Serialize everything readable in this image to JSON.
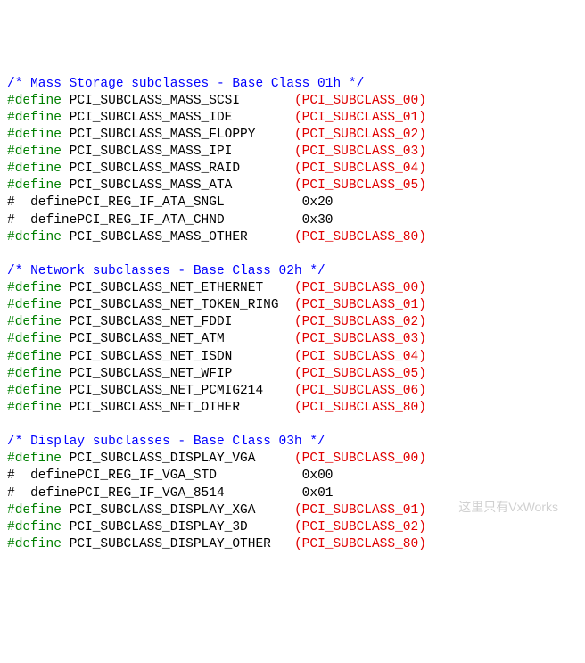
{
  "sections": [
    {
      "comment": "/* Mass Storage subclasses - Base Class 01h */",
      "lines": [
        {
          "directive": "#define",
          "name": "PCI_SUBCLASS_MASS_SCSI",
          "value": "(PCI_SUBCLASS_00)",
          "mode": "green"
        },
        {
          "directive": "#define",
          "name": "PCI_SUBCLASS_MASS_IDE",
          "value": "(PCI_SUBCLASS_01)",
          "mode": "green"
        },
        {
          "directive": "#define",
          "name": "PCI_SUBCLASS_MASS_FLOPPY",
          "value": "(PCI_SUBCLASS_02)",
          "mode": "green"
        },
        {
          "directive": "#define",
          "name": "PCI_SUBCLASS_MASS_IPI",
          "value": "(PCI_SUBCLASS_03)",
          "mode": "green"
        },
        {
          "directive": "#define",
          "name": "PCI_SUBCLASS_MASS_RAID",
          "value": "(PCI_SUBCLASS_04)",
          "mode": "green"
        },
        {
          "directive": "#define",
          "name": "PCI_SUBCLASS_MASS_ATA",
          "value": "(PCI_SUBCLASS_05)",
          "mode": "green"
        },
        {
          "directive": "#  define",
          "name": "PCI_REG_IF_ATA_SNGL",
          "value": "0x20",
          "mode": "black"
        },
        {
          "directive": "#  define",
          "name": "PCI_REG_IF_ATA_CHND",
          "value": "0x30",
          "mode": "black"
        },
        {
          "directive": "#define",
          "name": "PCI_SUBCLASS_MASS_OTHER",
          "value": "(PCI_SUBCLASS_80)",
          "mode": "green"
        }
      ]
    },
    {
      "comment": "/* Network subclasses - Base Class 02h */",
      "lines": [
        {
          "directive": "#define",
          "name": "PCI_SUBCLASS_NET_ETHERNET",
          "value": "(PCI_SUBCLASS_00)",
          "mode": "green"
        },
        {
          "directive": "#define",
          "name": "PCI_SUBCLASS_NET_TOKEN_RING",
          "value": "(PCI_SUBCLASS_01)",
          "mode": "green"
        },
        {
          "directive": "#define",
          "name": "PCI_SUBCLASS_NET_FDDI",
          "value": "(PCI_SUBCLASS_02)",
          "mode": "green"
        },
        {
          "directive": "#define",
          "name": "PCI_SUBCLASS_NET_ATM",
          "value": "(PCI_SUBCLASS_03)",
          "mode": "green"
        },
        {
          "directive": "#define",
          "name": "PCI_SUBCLASS_NET_ISDN",
          "value": "(PCI_SUBCLASS_04)",
          "mode": "green"
        },
        {
          "directive": "#define",
          "name": "PCI_SUBCLASS_NET_WFIP",
          "value": "(PCI_SUBCLASS_05)",
          "mode": "green"
        },
        {
          "directive": "#define",
          "name": "PCI_SUBCLASS_NET_PCMIG214",
          "value": "(PCI_SUBCLASS_06)",
          "mode": "green"
        },
        {
          "directive": "#define",
          "name": "PCI_SUBCLASS_NET_OTHER",
          "value": "(PCI_SUBCLASS_80)",
          "mode": "green"
        }
      ]
    },
    {
      "comment": "/* Display subclasses - Base Class 03h */",
      "lines": [
        {
          "directive": "#define",
          "name": "PCI_SUBCLASS_DISPLAY_VGA",
          "value": "(PCI_SUBCLASS_00)",
          "mode": "green"
        },
        {
          "directive": "#  define",
          "name": "PCI_REG_IF_VGA_STD",
          "value": "0x00",
          "mode": "black"
        },
        {
          "directive": "#  define",
          "name": "PCI_REG_IF_VGA_8514",
          "value": "0x01",
          "mode": "black"
        },
        {
          "directive": "#define",
          "name": "PCI_SUBCLASS_DISPLAY_XGA",
          "value": "(PCI_SUBCLASS_01)",
          "mode": "green"
        },
        {
          "directive": "#define",
          "name": "PCI_SUBCLASS_DISPLAY_3D",
          "value": "(PCI_SUBCLASS_02)",
          "mode": "green"
        },
        {
          "directive": "#define",
          "name": "PCI_SUBCLASS_DISPLAY_OTHER",
          "value": "(PCI_SUBCLASS_80)",
          "mode": "green"
        }
      ]
    }
  ],
  "columns": {
    "nameCol": 8,
    "valueCol": 37,
    "blackValueCol": 38
  },
  "watermark": "这里只有VxWorks"
}
